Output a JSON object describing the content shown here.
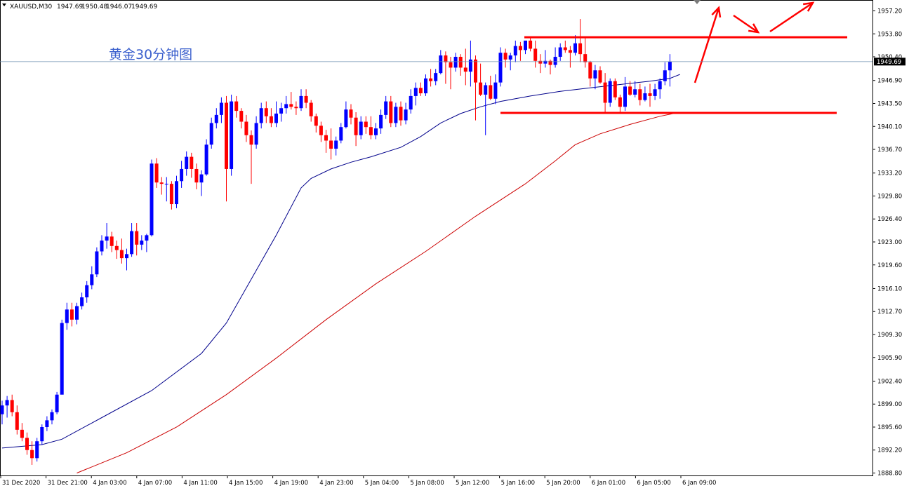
{
  "header": {
    "symbol": "XAUUSD,M30",
    "open": "1947.69",
    "high": "1950.48",
    "low": "1946.07",
    "close": "1949.69"
  },
  "annotation": {
    "text": "黄金30分钟图"
  },
  "current_price": "1949.69",
  "colors": {
    "bull": "#0000ff",
    "bear": "#ff0000",
    "ma_fast": "#00008b",
    "ma_slow": "#cc0000",
    "drawing": "#ff0000",
    "price_line": "#6b8caf",
    "price_tag_bg": "#000000"
  },
  "chart_data": {
    "type": "candlestick",
    "title": "",
    "ylim": [
      1888.8,
      1959.0
    ],
    "y_ticks": [
      "1957.20",
      "1953.80",
      "1950.40",
      "1946.90",
      "1943.50",
      "1940.10",
      "1936.70",
      "1933.20",
      "1929.80",
      "1926.40",
      "1923.00",
      "1919.60",
      "1916.10",
      "1912.70",
      "1909.30",
      "1905.90",
      "1902.40",
      "1899.00",
      "1895.60",
      "1892.20",
      "1888.80"
    ],
    "x_ticks": [
      "31 Dec 2020",
      "31 Dec 21:00",
      "4 Jan 03:00",
      "4 Jan 07:00",
      "4 Jan 11:00",
      "4 Jan 15:00",
      "4 Jan 19:00",
      "4 Jan 23:00",
      "5 Jan 04:00",
      "5 Jan 08:00",
      "5 Jan 12:00",
      "5 Jan 16:00",
      "5 Jan 20:00",
      "6 Jan 01:00",
      "6 Jan 05:00",
      "6 Jan 09:00"
    ],
    "candles": [
      [
        1897.5,
        1899.5,
        1896.0,
        1898.8
      ],
      [
        1898.8,
        1900.2,
        1897.0,
        1899.6
      ],
      [
        1899.6,
        1900.4,
        1897.2,
        1897.8
      ],
      [
        1897.8,
        1898.8,
        1894.5,
        1895.2
      ],
      [
        1895.2,
        1896.2,
        1893.5,
        1894.0
      ],
      [
        1894.0,
        1894.8,
        1891.5,
        1892.2
      ],
      [
        1892.2,
        1893.5,
        1890.0,
        1891.0
      ],
      [
        1891.0,
        1894.0,
        1890.5,
        1893.5
      ],
      [
        1893.5,
        1896.0,
        1893.0,
        1895.6
      ],
      [
        1895.6,
        1897.2,
        1895.0,
        1896.6
      ],
      [
        1896.6,
        1898.2,
        1896.0,
        1897.8
      ],
      [
        1897.8,
        1900.8,
        1897.5,
        1900.4
      ],
      [
        1900.4,
        1911.5,
        1904.0,
        1911.0
      ],
      [
        1911.0,
        1914.0,
        1910.0,
        1913.0
      ],
      [
        1913.0,
        1914.0,
        1910.5,
        1911.5
      ],
      [
        1911.5,
        1914.0,
        1910.8,
        1913.5
      ],
      [
        1913.5,
        1915.5,
        1913.0,
        1914.8
      ],
      [
        1914.8,
        1917.2,
        1914.0,
        1916.6
      ],
      [
        1916.6,
        1919.4,
        1916.0,
        1918.2
      ],
      [
        1918.2,
        1922.2,
        1917.8,
        1921.6
      ],
      [
        1921.6,
        1924.0,
        1921.0,
        1923.2
      ],
      [
        1923.2,
        1925.8,
        1922.0,
        1923.8
      ],
      [
        1923.8,
        1924.5,
        1921.5,
        1922.4
      ],
      [
        1922.4,
        1923.2,
        1920.5,
        1921.8
      ],
      [
        1921.8,
        1923.5,
        1919.8,
        1920.6
      ],
      [
        1920.6,
        1922.0,
        1918.8,
        1921.2
      ],
      [
        1921.2,
        1925.8,
        1920.8,
        1924.6
      ],
      [
        1924.6,
        1925.8,
        1921.0,
        1922.6
      ],
      [
        1922.6,
        1924.0,
        1921.8,
        1923.2
      ],
      [
        1923.2,
        1924.2,
        1921.5,
        1924.0
      ],
      [
        1924.0,
        1935.2,
        1923.8,
        1934.6
      ],
      [
        1934.6,
        1935.4,
        1931.0,
        1931.8
      ],
      [
        1931.8,
        1932.6,
        1930.0,
        1931.6
      ],
      [
        1931.6,
        1932.6,
        1929.0,
        1931.6
      ],
      [
        1931.6,
        1932.0,
        1927.8,
        1928.6
      ],
      [
        1928.6,
        1932.8,
        1928.0,
        1932.0
      ],
      [
        1932.0,
        1935.0,
        1931.0,
        1933.8
      ],
      [
        1933.8,
        1936.4,
        1932.8,
        1935.6
      ],
      [
        1935.6,
        1936.2,
        1932.5,
        1933.8
      ],
      [
        1933.8,
        1934.6,
        1930.8,
        1931.8
      ],
      [
        1931.8,
        1933.6,
        1929.8,
        1933.0
      ],
      [
        1933.0,
        1938.2,
        1932.8,
        1937.4
      ],
      [
        1937.4,
        1941.4,
        1936.8,
        1940.6
      ],
      [
        1940.6,
        1942.8,
        1939.8,
        1941.8
      ],
      [
        1941.8,
        1944.4,
        1940.6,
        1943.6
      ],
      [
        1943.6,
        1944.6,
        1929.0,
        1933.8
      ],
      [
        1933.8,
        1944.8,
        1932.8,
        1943.8
      ],
      [
        1943.8,
        1944.6,
        1941.4,
        1942.4
      ],
      [
        1942.4,
        1942.8,
        1939.8,
        1940.8
      ],
      [
        1940.8,
        1941.8,
        1937.8,
        1938.8
      ],
      [
        1938.8,
        1939.5,
        1931.6,
        1937.4
      ],
      [
        1937.4,
        1941.6,
        1936.8,
        1940.6
      ],
      [
        1940.6,
        1943.6,
        1939.8,
        1942.8
      ],
      [
        1942.8,
        1943.8,
        1940.6,
        1941.6
      ],
      [
        1941.6,
        1942.8,
        1940.0,
        1940.6
      ],
      [
        1940.6,
        1943.8,
        1940.0,
        1942.0
      ],
      [
        1942.0,
        1943.6,
        1940.8,
        1942.8
      ],
      [
        1942.8,
        1944.6,
        1942.0,
        1943.4
      ],
      [
        1943.4,
        1945.2,
        1942.6,
        1943.0
      ],
      [
        1943.0,
        1943.8,
        1941.8,
        1942.8
      ],
      [
        1942.8,
        1945.6,
        1942.4,
        1944.6
      ],
      [
        1944.6,
        1945.6,
        1942.8,
        1943.6
      ],
      [
        1943.6,
        1944.0,
        1940.8,
        1941.6
      ],
      [
        1941.6,
        1942.0,
        1939.2,
        1940.2
      ],
      [
        1940.2,
        1940.8,
        1937.8,
        1938.8
      ],
      [
        1938.8,
        1939.6,
        1936.2,
        1938.0
      ],
      [
        1938.0,
        1939.8,
        1935.2,
        1936.8
      ],
      [
        1936.8,
        1938.6,
        1935.8,
        1938.0
      ],
      [
        1938.0,
        1940.6,
        1937.6,
        1940.0
      ],
      [
        1940.0,
        1943.8,
        1939.8,
        1942.6
      ],
      [
        1942.6,
        1943.4,
        1940.4,
        1941.4
      ],
      [
        1941.4,
        1942.2,
        1937.2,
        1938.8
      ],
      [
        1938.8,
        1941.6,
        1938.2,
        1940.8
      ],
      [
        1940.8,
        1941.6,
        1939.0,
        1940.0
      ],
      [
        1940.0,
        1941.6,
        1938.2,
        1938.8
      ],
      [
        1938.8,
        1940.6,
        1938.2,
        1939.8
      ],
      [
        1939.8,
        1942.6,
        1939.0,
        1941.8
      ],
      [
        1941.8,
        1944.6,
        1941.2,
        1943.8
      ],
      [
        1943.8,
        1944.6,
        1940.0,
        1940.6
      ],
      [
        1940.6,
        1943.6,
        1940.0,
        1943.0
      ],
      [
        1943.0,
        1943.8,
        1940.2,
        1941.0
      ],
      [
        1941.0,
        1943.6,
        1940.4,
        1942.6
      ],
      [
        1942.6,
        1945.6,
        1942.0,
        1944.6
      ],
      [
        1944.6,
        1946.6,
        1943.2,
        1945.8
      ],
      [
        1945.8,
        1946.6,
        1944.6,
        1945.0
      ],
      [
        1945.0,
        1947.8,
        1944.6,
        1947.2
      ],
      [
        1947.2,
        1948.6,
        1946.0,
        1946.8
      ],
      [
        1946.8,
        1948.6,
        1946.2,
        1948.0
      ],
      [
        1948.0,
        1951.4,
        1947.8,
        1950.6
      ],
      [
        1950.6,
        1951.2,
        1946.4,
        1949.6
      ],
      [
        1949.6,
        1950.4,
        1945.6,
        1948.8
      ],
      [
        1948.8,
        1951.0,
        1948.2,
        1950.4
      ],
      [
        1950.4,
        1950.8,
        1947.6,
        1948.8
      ],
      [
        1948.8,
        1951.6,
        1946.2,
        1948.2
      ],
      [
        1948.2,
        1952.8,
        1946.0,
        1950.0
      ],
      [
        1950.0,
        1950.6,
        1941.0,
        1946.6
      ],
      [
        1946.6,
        1949.4,
        1944.6,
        1944.8
      ],
      [
        1944.8,
        1946.6,
        1938.8,
        1946.2
      ],
      [
        1946.2,
        1947.6,
        1944.0,
        1944.2
      ],
      [
        1944.2,
        1947.8,
        1943.4,
        1946.6
      ],
      [
        1946.6,
        1951.8,
        1946.0,
        1951.0
      ],
      [
        1951.0,
        1951.6,
        1948.8,
        1950.0
      ],
      [
        1950.0,
        1951.0,
        1948.4,
        1950.6
      ],
      [
        1950.6,
        1952.8,
        1949.6,
        1952.0
      ],
      [
        1952.0,
        1952.6,
        1949.8,
        1951.4
      ],
      [
        1951.4,
        1952.6,
        1950.8,
        1952.8
      ],
      [
        1952.8,
        1953.4,
        1951.2,
        1951.6
      ],
      [
        1951.6,
        1952.8,
        1948.8,
        1949.8
      ],
      [
        1949.8,
        1950.8,
        1948.0,
        1949.4
      ],
      [
        1949.4,
        1951.4,
        1948.8,
        1949.8
      ],
      [
        1949.8,
        1950.0,
        1947.8,
        1949.2
      ],
      [
        1949.2,
        1951.8,
        1948.8,
        1950.4
      ],
      [
        1950.4,
        1952.4,
        1949.8,
        1951.8
      ],
      [
        1951.8,
        1952.8,
        1951.0,
        1951.4
      ],
      [
        1951.4,
        1952.0,
        1948.8,
        1951.0
      ],
      [
        1951.0,
        1953.6,
        1950.6,
        1952.4
      ],
      [
        1952.4,
        1956.0,
        1949.6,
        1950.8
      ],
      [
        1950.8,
        1953.4,
        1948.8,
        1949.6
      ],
      [
        1949.6,
        1949.8,
        1946.0,
        1947.2
      ],
      [
        1947.2,
        1949.2,
        1945.6,
        1948.4
      ],
      [
        1948.4,
        1949.0,
        1946.4,
        1946.6
      ],
      [
        1946.6,
        1948.0,
        1942.2,
        1943.6
      ],
      [
        1943.6,
        1947.2,
        1943.0,
        1946.8
      ],
      [
        1946.8,
        1947.2,
        1944.0,
        1944.4
      ],
      [
        1944.4,
        1944.8,
        1942.0,
        1943.0
      ],
      [
        1943.0,
        1947.4,
        1942.4,
        1946.0
      ],
      [
        1946.0,
        1946.8,
        1944.6,
        1944.8
      ],
      [
        1944.8,
        1946.8,
        1944.4,
        1945.6
      ],
      [
        1945.6,
        1946.4,
        1943.2,
        1944.0
      ],
      [
        1944.0,
        1946.0,
        1943.8,
        1945.0
      ],
      [
        1945.0,
        1946.4,
        1943.0,
        1944.6
      ],
      [
        1944.6,
        1946.4,
        1944.0,
        1945.6
      ],
      [
        1945.6,
        1947.2,
        1944.2,
        1946.8
      ],
      [
        1946.8,
        1949.6,
        1946.2,
        1948.4
      ],
      [
        1948.4,
        1950.8,
        1946.0,
        1949.69
      ]
    ],
    "ma_fast": [
      [
        0,
        1892.5
      ],
      [
        8,
        1893.0
      ],
      [
        12,
        1893.8
      ],
      [
        20,
        1897.0
      ],
      [
        30,
        1901.0
      ],
      [
        40,
        1906.5
      ],
      [
        45,
        1911.0
      ],
      [
        50,
        1917.5
      ],
      [
        55,
        1924.0
      ],
      [
        60,
        1931.0
      ],
      [
        62,
        1932.4
      ],
      [
        66,
        1933.8
      ],
      [
        70,
        1934.8
      ],
      [
        74,
        1935.6
      ],
      [
        80,
        1937.0
      ],
      [
        84,
        1938.6
      ],
      [
        88,
        1940.6
      ],
      [
        92,
        1942.0
      ],
      [
        96,
        1943.0
      ],
      [
        100,
        1943.8
      ],
      [
        106,
        1944.6
      ],
      [
        112,
        1945.3
      ],
      [
        118,
        1945.8
      ],
      [
        124,
        1946.3
      ],
      [
        130,
        1946.8
      ],
      [
        134,
        1947.2
      ],
      [
        136,
        1947.8
      ]
    ],
    "ma_slow": [
      [
        15,
        1888.8
      ],
      [
        25,
        1891.8
      ],
      [
        35,
        1895.6
      ],
      [
        45,
        1900.4
      ],
      [
        55,
        1905.8
      ],
      [
        65,
        1911.5
      ],
      [
        75,
        1916.8
      ],
      [
        85,
        1921.6
      ],
      [
        95,
        1926.8
      ],
      [
        105,
        1931.6
      ],
      [
        111,
        1935.0
      ],
      [
        115,
        1937.4
      ],
      [
        120,
        1939.0
      ],
      [
        126,
        1940.4
      ],
      [
        132,
        1941.6
      ],
      [
        136,
        1942.2
      ]
    ],
    "drawings": {
      "resistance": 1953.3,
      "support": 1942.1
    },
    "grid": false
  }
}
